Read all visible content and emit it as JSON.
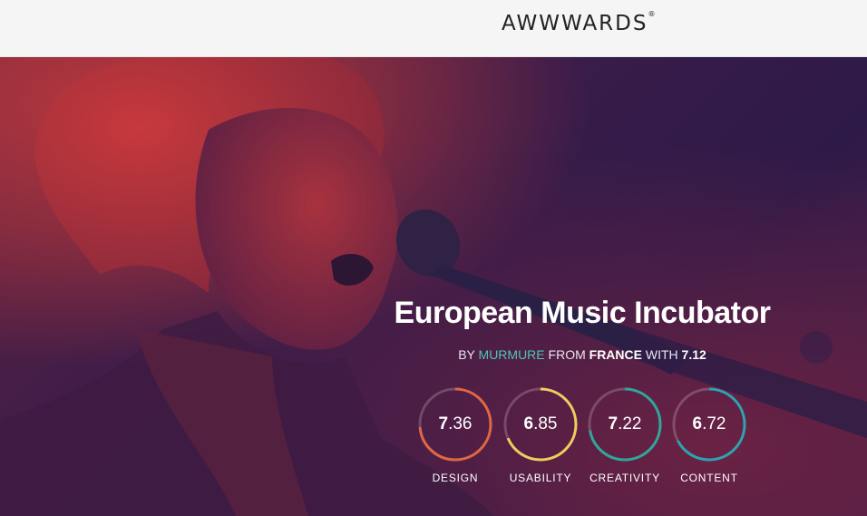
{
  "header": {
    "logo_text": "AWWWARDS",
    "logo_mark": "®"
  },
  "hero": {
    "title": "European Music Incubator",
    "byline": {
      "by": "BY",
      "author": "MURMURE",
      "from": "FROM",
      "country": "FRANCE",
      "with": "WITH",
      "score": "7.12"
    },
    "scores": [
      {
        "label": "DESIGN",
        "int": "7",
        "dec": ".36",
        "value": 7.36,
        "color": "#e0673f"
      },
      {
        "label": "USABILITY",
        "int": "6",
        "dec": ".85",
        "value": 6.85,
        "color": "#f0cc5e"
      },
      {
        "label": "CREATIVITY",
        "int": "7",
        "dec": ".22",
        "value": 7.22,
        "color": "#2fa69a"
      },
      {
        "label": "CONTENT",
        "int": "6",
        "dec": ".72",
        "value": 6.72,
        "color": "#2aa3b2"
      }
    ]
  }
}
